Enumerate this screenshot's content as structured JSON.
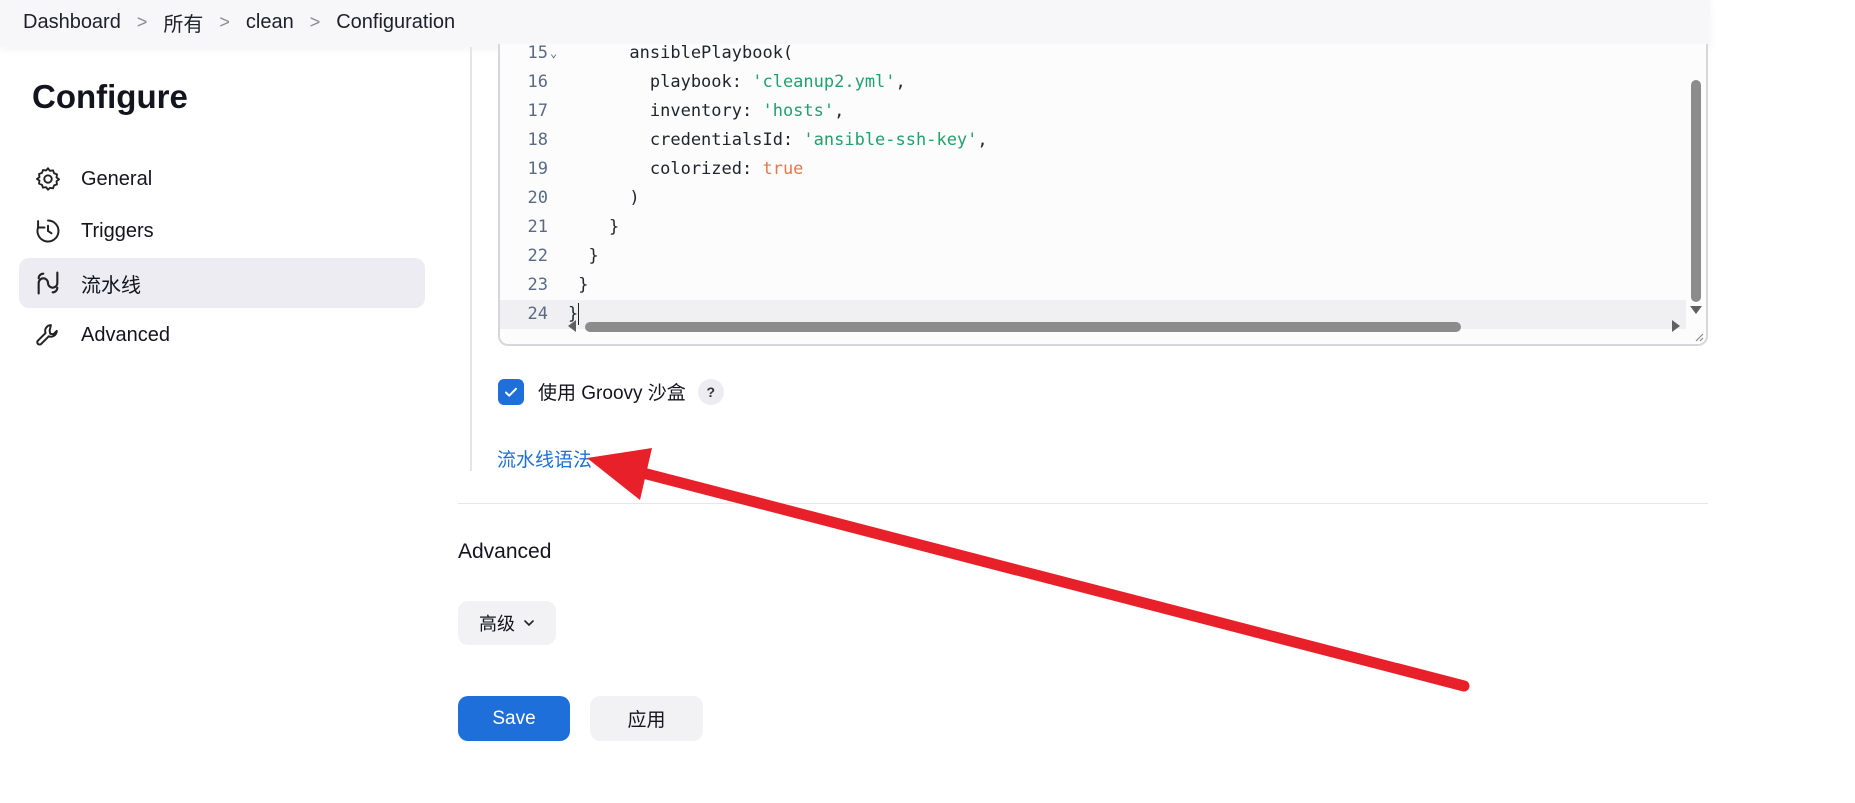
{
  "breadcrumb": {
    "items": [
      "Dashboard",
      "所有",
      "clean",
      "Configuration"
    ],
    "separator": ">"
  },
  "sidebar": {
    "title": "Configure",
    "items": [
      {
        "label": "General",
        "icon": "gear-icon"
      },
      {
        "label": "Triggers",
        "icon": "clock-icon"
      },
      {
        "label": "流水线",
        "icon": "pipeline-icon",
        "active": true
      },
      {
        "label": "Advanced",
        "icon": "wrench-icon"
      }
    ]
  },
  "editor": {
    "lines": [
      {
        "n": "15",
        "code": "      ansiblePlaybook(",
        "folded": true
      },
      {
        "n": "16",
        "code": "        playbook: ",
        "str": "'cleanup2.yml'",
        "tail": ","
      },
      {
        "n": "17",
        "code": "        inventory: ",
        "str": "'hosts'",
        "tail": ","
      },
      {
        "n": "18",
        "code": "        credentialsId: ",
        "str": "'ansible-ssh-key'",
        "tail": ","
      },
      {
        "n": "19",
        "code": "        colorized: ",
        "kw": "true"
      },
      {
        "n": "20",
        "code": "      )"
      },
      {
        "n": "21",
        "code": "    }"
      },
      {
        "n": "22",
        "code": "  }"
      },
      {
        "n": "23",
        "code": " }"
      },
      {
        "n": "24",
        "code": "}"
      }
    ]
  },
  "sandbox": {
    "label": "使用 Groovy 沙盒",
    "checked": true,
    "help": "?"
  },
  "pipeline_syntax_link": "流水线语法",
  "advanced": {
    "title": "Advanced",
    "button_label": "高级"
  },
  "actions": {
    "save_label": "Save",
    "apply_label": "应用"
  },
  "colors": {
    "accent": "#1e6fd9",
    "annotation_arrow": "#e8202a",
    "string": "#22a06b",
    "keyword": "#e5794a"
  }
}
